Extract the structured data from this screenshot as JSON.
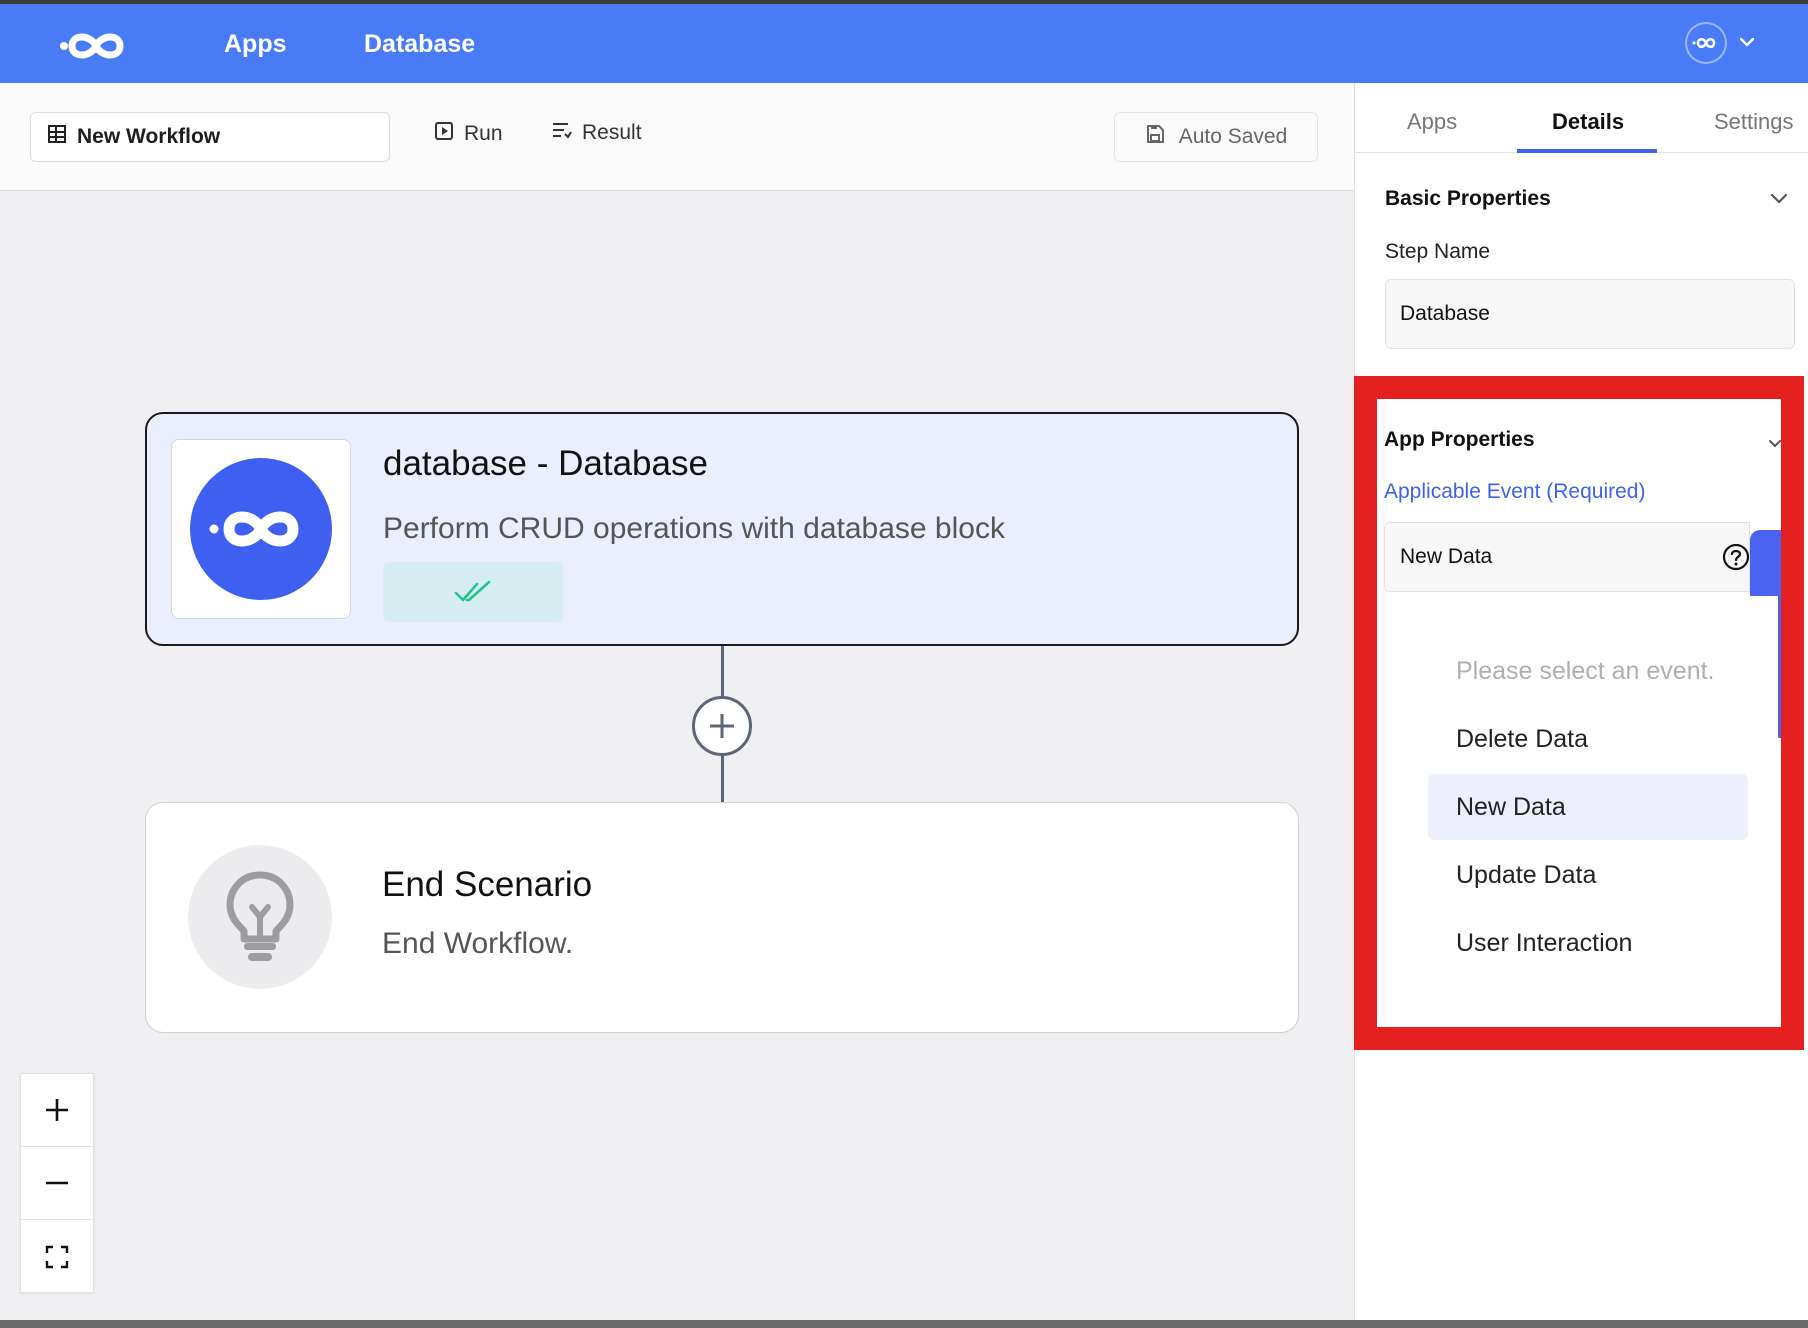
{
  "header": {
    "nav": {
      "apps": "Apps",
      "database": "Database"
    },
    "brand_color": "#4a7bf7"
  },
  "toolbar": {
    "workflow_name": "New Workflow",
    "run_label": "Run",
    "result_label": "Result",
    "auto_saved_label": "Auto Saved"
  },
  "canvas": {
    "nodes": [
      {
        "title": "database - Database",
        "description": "Perform CRUD operations with database block",
        "icon": "database-app-logo",
        "status": "double-check-icon"
      },
      {
        "title": "End Scenario",
        "description": "End Workflow.",
        "icon": "lightbulb-icon"
      }
    ]
  },
  "panel": {
    "tabs": {
      "apps": "Apps",
      "details": "Details",
      "settings": "Settings"
    },
    "active_tab": "Details",
    "basic_properties": {
      "title": "Basic Properties",
      "step_name_label": "Step Name",
      "step_name_value": "Database"
    },
    "app_properties": {
      "title": "App Properties",
      "event_label": "Applicable Event (Required)",
      "selected_event": "New Data",
      "options": {
        "placeholder": "Please select an event.",
        "delete": "Delete Data",
        "new": "New Data",
        "update": "Update Data",
        "user": "User Interaction"
      }
    }
  },
  "colors": {
    "accent": "#3d63ea",
    "highlight_box": "#e52020",
    "status_check": "#22c58a"
  }
}
